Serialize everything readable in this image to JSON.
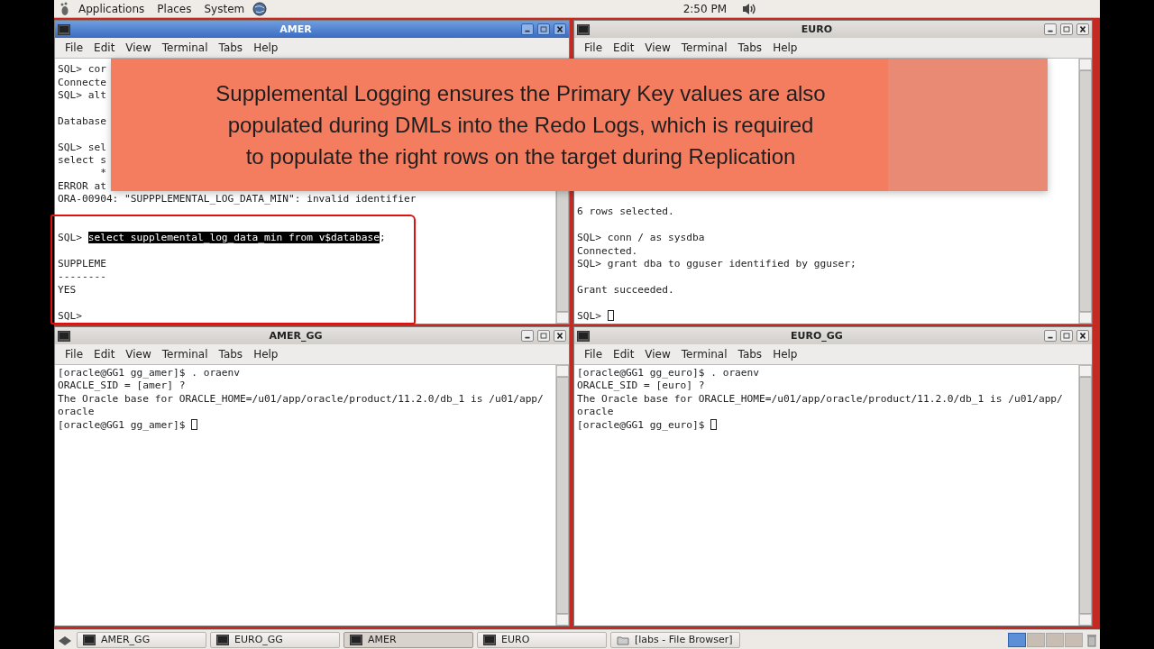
{
  "top_panel": {
    "menus": [
      "Applications",
      "Places",
      "System"
    ],
    "clock": "2:50 PM"
  },
  "windows": [
    {
      "title": "AMER",
      "active": true,
      "menu": [
        "File",
        "Edit",
        "View",
        "Terminal",
        "Tabs",
        "Help"
      ],
      "lines": [
        {
          "kind": "text",
          "text": "SQL> cor"
        },
        {
          "kind": "text",
          "text": "Connecte"
        },
        {
          "kind": "text",
          "text": "SQL> alt"
        },
        {
          "kind": "blank"
        },
        {
          "kind": "text",
          "text": "Database"
        },
        {
          "kind": "blank"
        },
        {
          "kind": "text",
          "text": "SQL> sel"
        },
        {
          "kind": "text",
          "text": "select s"
        },
        {
          "kind": "text",
          "text": "       *"
        },
        {
          "kind": "text",
          "text": "ERROR at"
        },
        {
          "kind": "text",
          "text": "ORA-00904: \"SUPPPLEMENTAL_LOG_DATA_MIN\": invalid identifier"
        },
        {
          "kind": "blank"
        },
        {
          "kind": "blank"
        },
        {
          "kind": "selection",
          "text": "SQL> ",
          "selection": "select supplemental_log_data_min from v$database",
          "after": ";"
        },
        {
          "kind": "blank"
        },
        {
          "kind": "text",
          "text": "SUPPLEME"
        },
        {
          "kind": "text",
          "text": "--------"
        },
        {
          "kind": "text",
          "text": "YES"
        },
        {
          "kind": "blank"
        },
        {
          "kind": "text",
          "text": "SQL>"
        }
      ]
    },
    {
      "title": "EURO",
      "active": false,
      "menu": [
        "File",
        "Edit",
        "View",
        "Terminal",
        "Tabs",
        "Help"
      ],
      "lines": [
        {
          "kind": "text",
          "text": "6 rows selected."
        },
        {
          "kind": "blank"
        },
        {
          "kind": "text",
          "text": "SQL> conn / as sysdba"
        },
        {
          "kind": "text",
          "text": "Connected."
        },
        {
          "kind": "text",
          "text": "SQL> grant dba to gguser identified by gguser;"
        },
        {
          "kind": "blank"
        },
        {
          "kind": "text",
          "text": "Grant succeeded."
        },
        {
          "kind": "blank"
        },
        {
          "kind": "prompt",
          "text": "SQL> "
        }
      ]
    },
    {
      "title": "AMER_GG",
      "active": false,
      "menu": [
        "File",
        "Edit",
        "View",
        "Terminal",
        "Tabs",
        "Help"
      ],
      "lines": [
        {
          "kind": "text",
          "text": "[oracle@GG1 gg_amer]$ . oraenv"
        },
        {
          "kind": "text",
          "text": "ORACLE_SID = [amer] ?"
        },
        {
          "kind": "text",
          "text": "The Oracle base for ORACLE_HOME=/u01/app/oracle/product/11.2.0/db_1 is /u01/app/"
        },
        {
          "kind": "text",
          "text": "oracle"
        },
        {
          "kind": "prompt",
          "text": "[oracle@GG1 gg_amer]$ "
        }
      ]
    },
    {
      "title": "EURO_GG",
      "active": false,
      "menu": [
        "File",
        "Edit",
        "View",
        "Terminal",
        "Tabs",
        "Help"
      ],
      "lines": [
        {
          "kind": "text",
          "text": "[oracle@GG1 gg_euro]$ . oraenv"
        },
        {
          "kind": "text",
          "text": "ORACLE_SID = [euro] ?"
        },
        {
          "kind": "text",
          "text": "The Oracle base for ORACLE_HOME=/u01/app/oracle/product/11.2.0/db_1 is /u01/app/"
        },
        {
          "kind": "text",
          "text": "oracle"
        },
        {
          "kind": "prompt",
          "text": "[oracle@GG1 gg_euro]$ "
        }
      ]
    }
  ],
  "banner": {
    "text": "Supplemental Logging ensures the Primary Key values are also\npopulated during DMLs into the Redo Logs, which is required\nto populate the right rows on the target during Replication"
  },
  "taskbar": {
    "tasks": [
      {
        "label": "AMER_GG",
        "kind": "terminal",
        "selected": false
      },
      {
        "label": "EURO_GG",
        "kind": "terminal",
        "selected": false
      },
      {
        "label": "AMER",
        "kind": "terminal",
        "selected": true
      },
      {
        "label": "EURO",
        "kind": "terminal",
        "selected": false
      },
      {
        "label": "[labs - File Browser]",
        "kind": "folder",
        "selected": false
      }
    ],
    "workspaces": [
      {
        "selected": true
      },
      {
        "selected": false
      },
      {
        "selected": false
      },
      {
        "selected": false
      }
    ]
  }
}
